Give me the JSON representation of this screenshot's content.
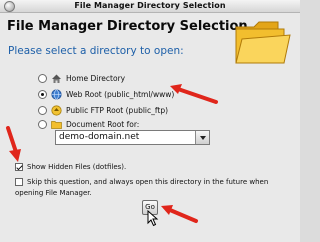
{
  "window": {
    "title": "File Manager Directory Selection"
  },
  "heading": "File Manager Directory Selection",
  "prompt": "Please select a directory to open:",
  "options": [
    {
      "label": "Home Directory",
      "icon": "home-icon",
      "checked": false
    },
    {
      "label": "Web Root (public_html/www)",
      "icon": "globe-icon",
      "checked": true
    },
    {
      "label": "Public FTP Root (public_ftp)",
      "icon": "ftp-icon",
      "checked": false
    },
    {
      "label": "Document Root for:",
      "icon": "folder-small-icon",
      "checked": false
    }
  ],
  "domain_select": {
    "value": "demo-domain.net"
  },
  "checkboxes": {
    "show_hidden": {
      "label": "Show Hidden Files (dotfiles).",
      "checked": true
    },
    "skip_question": {
      "label_line1": "Skip this question, and always open this directory in the future when",
      "label_line2": "opening File Manager.",
      "checked": false
    }
  },
  "ok_button": {
    "label": "Go"
  },
  "colors": {
    "arrow": "#e0261b",
    "prompt_text": "#1d5fa8",
    "background": "#e9e9e9"
  }
}
